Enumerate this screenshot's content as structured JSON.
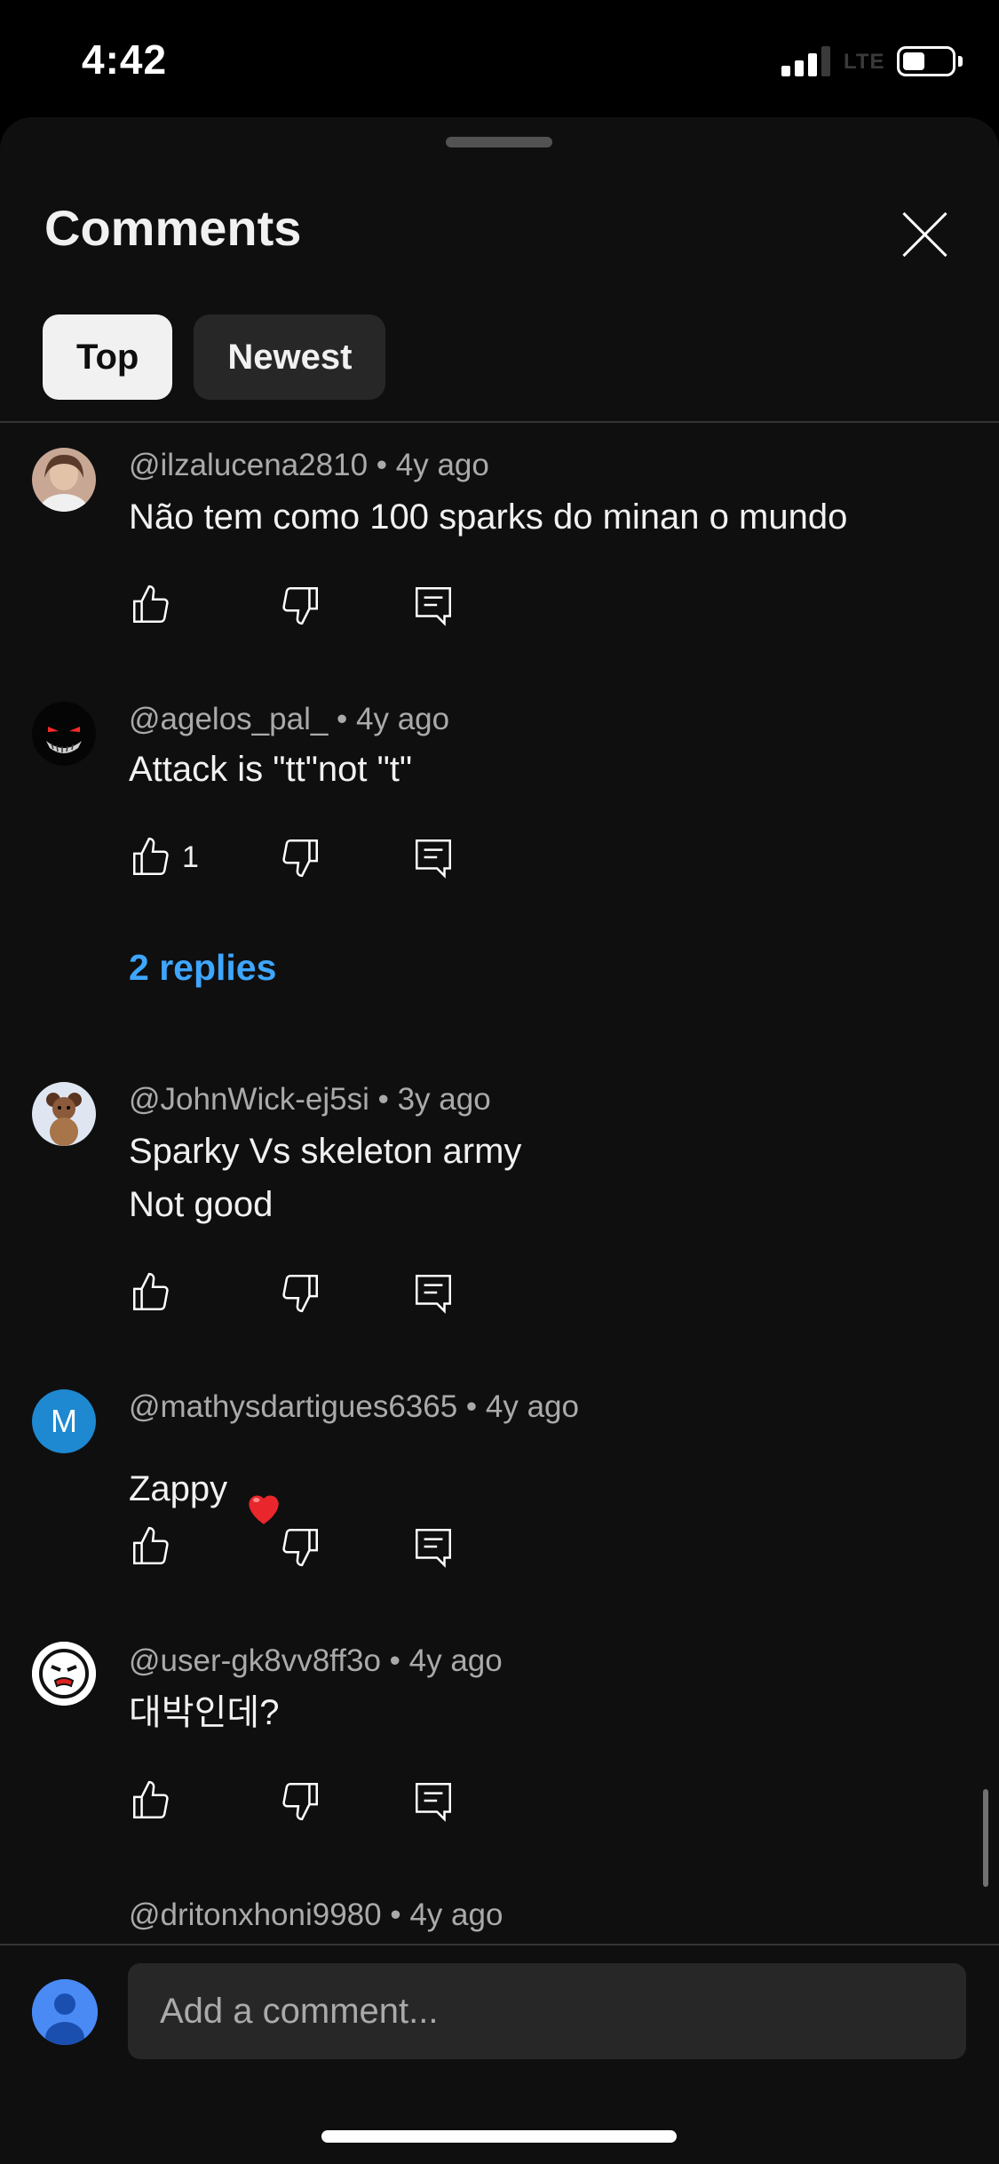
{
  "status_bar": {
    "time": "4:42",
    "network": "LTE"
  },
  "sheet": {
    "title": "Comments",
    "tabs": [
      {
        "label": "Top",
        "active": true
      },
      {
        "label": "Newest",
        "active": false
      }
    ]
  },
  "comments": [
    {
      "author": "@ilzalucena2810",
      "time": "4y ago",
      "text": "Não tem como 100 sparks do minan o mundo",
      "likes": ""
    },
    {
      "author": "@agelos_pal_",
      "time": "4y ago",
      "text": "Attack is \"tt\"not \"t\"",
      "likes": "1",
      "replies": "2 replies"
    },
    {
      "author": "@JohnWick-ej5si",
      "time": "3y ago",
      "text": "Sparky Vs skeleton army\nNot good",
      "likes": ""
    },
    {
      "author": "@mathysdartigues6365",
      "time": "4y ago",
      "text": "Zappy",
      "likes": "",
      "avatar_letter": "M"
    },
    {
      "author": "@user-gk8vv8ff3o",
      "time": "4y ago",
      "text": "대박인데?",
      "likes": ""
    },
    {
      "author": "@dritonxhoni9980",
      "time": "4y ago"
    }
  ],
  "composer": {
    "placeholder": "Add a comment..."
  },
  "colors": {
    "sheet_bg": "#0f0f0f",
    "link": "#3ea6ff",
    "meta": "#aaaaaa",
    "chip_active": "#f1f1f1",
    "chip_inactive": "#272727"
  },
  "icons": [
    "like-icon",
    "dislike-icon",
    "reply-icon",
    "close-icon",
    "heart-emoji-icon"
  ]
}
